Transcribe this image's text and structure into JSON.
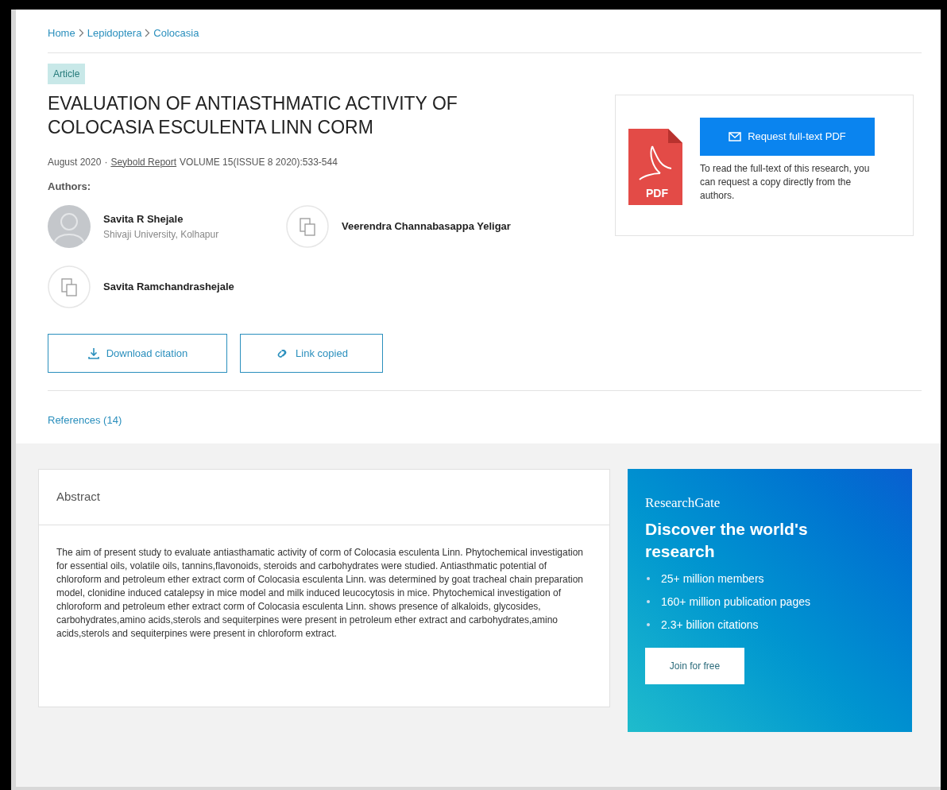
{
  "breadcrumb": [
    "Home",
    "Lepidoptera",
    "Colocasia"
  ],
  "badge": "Article",
  "title": "EVALUATION OF ANTIASTHMATIC ACTIVITY OF COLOCASIA ESCULENTA LINN CORM",
  "meta": {
    "date": "August 2020",
    "separator": "·",
    "journal": "Seybold Report",
    "details": "VOLUME 15(ISSUE 8 2020):533-544"
  },
  "authors_label": "Authors:",
  "authors": [
    {
      "kind": "person",
      "name": "Savita R Shejale",
      "affiliation": "Shivaji University, Kolhapur"
    },
    {
      "kind": "unclaimed",
      "name": "Veerendra Channabasappa Yeligar"
    },
    {
      "kind": "unclaimed",
      "name": "Savita Ramchandrashejale"
    }
  ],
  "actions": [
    {
      "kind": "download",
      "label": "Download citation"
    },
    {
      "kind": "link",
      "label": "Link copied"
    }
  ],
  "references_tab": "References (14)",
  "pdf_card": {
    "icon_label": "PDF",
    "button": "Request full-text PDF",
    "text": "To read the full-text of this research, you can request a copy directly from the authors."
  },
  "abstract": {
    "heading": "Abstract",
    "text": "The aim of present study to evaluate antiasthamatic activity of corm of Colocasia esculenta Linn. Phytochemical investigation for essential oils, volatile oils, tannins,flavonoids, steroids and carbohydrates were studied. Antiasthmatic potential of chloroform and petroleum ether extract corm of Colocasia esculenta Linn. was determined by goat tracheal chain preparation model, clonidine induced catalepsy in mice model and milk induced leucocytosis in mice. Phytochemical investigation of chloroform and petroleum ether extract corm of Colocasia esculenta Linn. shows presence of alkaloids, glycosides, carbohydrates,amino acids,sterols and sequiterpines were present in petroleum ether extract and carbohydrates,amino acids,sterols and sequiterpines were present in chloroform extract."
  },
  "promo": {
    "brand": "ResearchGate",
    "headline": "Discover the world's research",
    "bullets": [
      "25+ million members",
      "160+ million publication pages",
      "2.3+ billion citations"
    ],
    "button": "Join for free"
  }
}
